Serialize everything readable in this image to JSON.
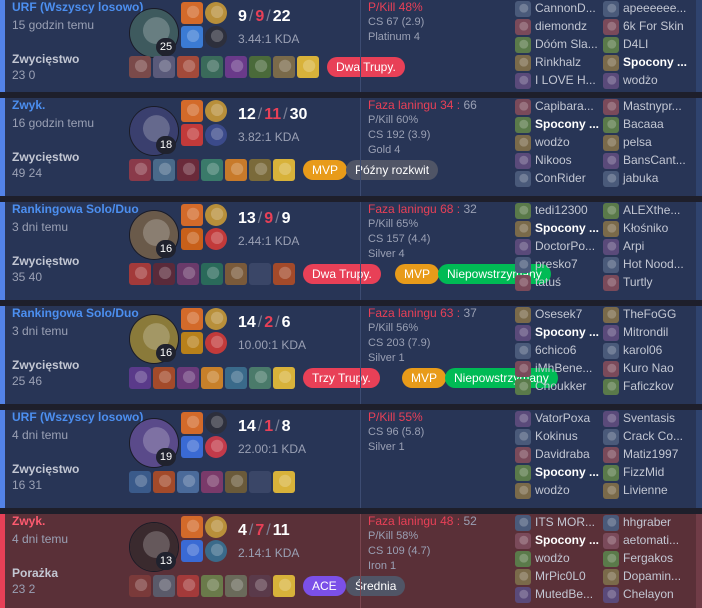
{
  "matches": [
    {
      "result": "win",
      "queue": "URF (Wszyscy losowo)",
      "time_ago": "15 godzin temu",
      "outcome": "Zwycięstwo",
      "duration": "23 0",
      "champ_color": "#3e5a5e",
      "level": "25",
      "spells": [
        "#d36a2a",
        "#3b7bd4"
      ],
      "runes": [
        "#b88f3a",
        "#2d2f3c"
      ],
      "kda": {
        "k": "9",
        "d": "9",
        "a": "22"
      },
      "ratio": "3.44:1 KDA",
      "items": [
        "#7a4a4a",
        "#5a5a7a",
        "#a34a3a",
        "#3a6a5a",
        "#6a3a8a",
        "#4a6a3a",
        "#7a6a4a",
        "#d8b23a"
      ],
      "badges": [
        {
          "label": "Dwa Trupy.",
          "color": "red"
        }
      ],
      "stats": {
        "laning_label": "",
        "laning_value": "",
        "laning_opp": "",
        "pkill": "P/Kill 48%",
        "cs": "CS 67 (2.9)",
        "rank": "Platinum 4"
      },
      "team1": [
        "CannonD...",
        "diemondz",
        "Dóóm Sla...",
        "Rinkhalz",
        "I LOVE H..."
      ],
      "team2": [
        "apeeeeee...",
        "6k For Skin",
        "D4LI",
        "Spocony ...",
        "wodżo"
      ],
      "me_in_team2": 3
    },
    {
      "result": "win",
      "queue": "Zwyk.",
      "time_ago": "16 godzin temu",
      "outcome": "Zwycięstwo",
      "duration": "49 24",
      "champ_color": "#3a3f6e",
      "level": "18",
      "spells": [
        "#d36a2a",
        "#c23a3a"
      ],
      "runes": [
        "#b88f3a",
        "#3b4a8a"
      ],
      "kda": {
        "k": "12",
        "d": "11",
        "a": "30"
      },
      "ratio": "3.82:1 KDA",
      "items": [
        "#8a3a4a",
        "#4a6a8a",
        "#6a2a3a",
        "#3a7a6a",
        "#c87a2a",
        "#7a6a3a",
        "#d8b23a"
      ],
      "badges": [
        {
          "label": "MVP",
          "color": "orange"
        },
        {
          "label": "Późny rozkwit",
          "color": "gray"
        }
      ],
      "stats": {
        "laning_label": "Faza laningu",
        "laning_value": "34",
        "laning_opp": "66",
        "pkill": "P/Kill 60%",
        "cs": "CS 192 (3.9)",
        "rank": "Gold 4"
      },
      "team1": [
        "Capibara...",
        "Spocony ...",
        "wodżo",
        "Nikoos",
        "ConRider"
      ],
      "team2": [
        "Mastnypr...",
        "Bacaaa",
        "pelsa",
        "BansCant...",
        "jabuka"
      ],
      "me_in_team1": 1
    },
    {
      "result": "win",
      "queue": "Rankingowa Solo/Duo",
      "time_ago": "3 dni temu",
      "outcome": "Zwycięstwo",
      "duration": "35 40",
      "champ_color": "#6a5a4a",
      "level": "16",
      "spells": [
        "#d36a2a",
        "#c8601a"
      ],
      "runes": [
        "#b88f3a",
        "#c23a3a"
      ],
      "kda": {
        "k": "13",
        "d": "9",
        "a": "9"
      },
      "ratio": "2.44:1 KDA",
      "items": [
        "#a33a3a",
        "#5a2a3a",
        "#6a3a6a",
        "#2a6a5a",
        "#7a5a3a",
        "",
        "#a34a2a"
      ],
      "badges": [
        {
          "label": "Dwa Trupy.",
          "color": "red"
        },
        {
          "label": "MVP",
          "color": "orange"
        },
        {
          "label": "Niepowstrzymany",
          "color": "green"
        }
      ],
      "stats": {
        "laning_label": "Faza laningu",
        "laning_value": "68",
        "laning_opp": "32",
        "pkill": "P/Kill 65%",
        "cs": "CS 157 (4.4)",
        "rank": "Silver 4"
      },
      "team1": [
        "tedi12300",
        "Spocony ...",
        "DoctorPo...",
        "presko7",
        "tatuś"
      ],
      "team2": [
        "ALEXthe...",
        "Kłośniko",
        "Arpi",
        "Hot Nood...",
        "Turtly"
      ],
      "me_in_team1": 1
    },
    {
      "result": "win",
      "queue": "Rankingowa Solo/Duo",
      "time_ago": "3 dni temu",
      "outcome": "Zwycięstwo",
      "duration": "25 46",
      "champ_color": "#8a7a3a",
      "level": "16",
      "spells": [
        "#d36a2a",
        "#b8801a"
      ],
      "runes": [
        "#b88f3a",
        "#c23a3a"
      ],
      "kda": {
        "k": "14",
        "d": "2",
        "a": "6"
      },
      "ratio": "10.00:1 KDA",
      "items": [
        "#5a3a8a",
        "#a34a2a",
        "#6a3a7a",
        "#c8802a",
        "#3a6a8a",
        "#4a7a6a",
        "#d8b23a"
      ],
      "badges": [
        {
          "label": "Trzy Trupy.",
          "color": "red"
        },
        {
          "label": "MVP",
          "color": "orange"
        },
        {
          "label": "Niepowstrzymany",
          "color": "green"
        }
      ],
      "stats": {
        "laning_label": "Faza laningu",
        "laning_value": "63",
        "laning_opp": "37",
        "pkill": "P/Kill 56%",
        "cs": "CS 203 (7.9)",
        "rank": "Silver 1"
      },
      "team1": [
        "Osesek7",
        "Spocony ...",
        "6chico6",
        "iMhBene...",
        "Choukker"
      ],
      "team2": [
        "TheFoGG",
        "Mitrondil",
        "karol06",
        "Kuro Nao",
        "Faficzkov"
      ],
      "me_in_team1": 1
    },
    {
      "result": "win",
      "queue": "URF (Wszyscy losowo)",
      "time_ago": "4 dni temu",
      "outcome": "Zwycięstwo",
      "duration": "16 31",
      "champ_color": "#5a4a8a",
      "level": "19",
      "spells": [
        "#d36a2a",
        "#3a6ad4"
      ],
      "runes": [
        "#2d2f3c",
        "#c23a4a"
      ],
      "kda": {
        "k": "14",
        "d": "1",
        "a": "8"
      },
      "ratio": "22.00:1 KDA",
      "items": [
        "#3a5a8a",
        "#a34a2a",
        "#4a6a9a",
        "#7a3a6a",
        "#6a5a3a",
        "",
        "#d8b23a"
      ],
      "badges": [],
      "stats": {
        "laning_label": "",
        "laning_value": "",
        "laning_opp": "",
        "pkill": "P/Kill 55%",
        "cs": "CS 96 (5.8)",
        "rank": "Silver 1"
      },
      "team1": [
        "VatorPoxa",
        "Kokinus",
        "Davidraba",
        "Spocony ...",
        "wodżo"
      ],
      "team2": [
        "Sventasis",
        "Crack Co...",
        "Matiz1997",
        "FizzMid",
        "Livienne"
      ],
      "me_in_team1": 3
    },
    {
      "result": "loss",
      "queue": "Zwyk.",
      "time_ago": "4 dni temu",
      "outcome": "Porażka",
      "duration": "23 2",
      "champ_color": "#3a2a2e",
      "level": "13",
      "spells": [
        "#d36a2a",
        "#3a6ad4"
      ],
      "runes": [
        "#b88f3a",
        "#3a6a8a"
      ],
      "kda": {
        "k": "4",
        "d": "7",
        "a": "11"
      },
      "ratio": "2.14:1 KDA",
      "items": [
        "#7a3a3a",
        "#5a5a6a",
        "#a33a3a",
        "#6a7a4a",
        "#6a6a5a",
        "#5a3a4a",
        "#d8b23a"
      ],
      "badges": [
        {
          "label": "ACE",
          "color": "purple"
        },
        {
          "label": "Średnia",
          "color": "gray"
        }
      ],
      "stats": {
        "laning_label": "Faza laningu",
        "laning_value": "48",
        "laning_opp": "52",
        "pkill": "P/Kill 58%",
        "cs": "CS 109 (4.7)",
        "rank": "Iron 1"
      },
      "team1": [
        "ITS MOR...",
        "Spocony ...",
        "wodżo",
        "MrPic0L0",
        "MutedBe..."
      ],
      "team2": [
        "hhgraber",
        "aetomati...",
        "Fergakos",
        "Dopamin...",
        "Chelayon"
      ],
      "me_in_team1": 1
    }
  ]
}
